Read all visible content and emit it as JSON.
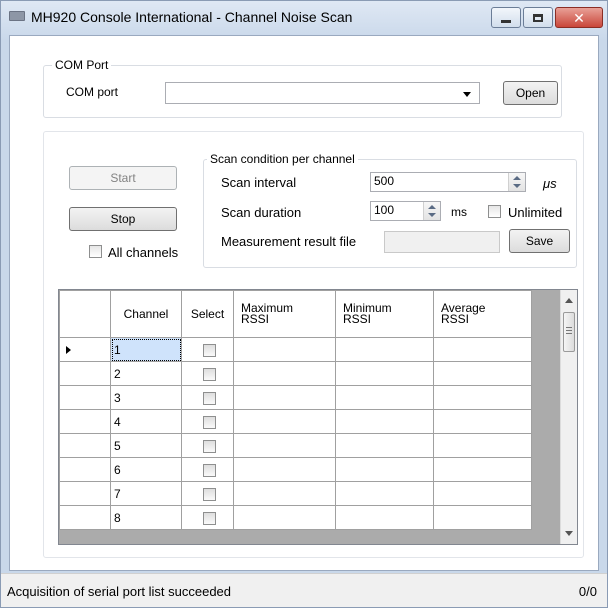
{
  "window": {
    "title": "MH920 Console International - Channel Noise Scan",
    "close_glyph": "✕"
  },
  "com_group": {
    "legend": "COM Port",
    "port_label": "COM port",
    "port_value": "",
    "open_label": "Open"
  },
  "controls": {
    "start_label": "Start",
    "start_enabled": false,
    "stop_label": "Stop",
    "all_channels_label": "All channels",
    "all_channels_checked": false
  },
  "scan_group": {
    "legend": "Scan condition per channel",
    "interval_label": "Scan interval",
    "interval_value": "500",
    "interval_unit": "μs",
    "duration_label": "Scan duration",
    "duration_value": "100",
    "duration_unit": "ms",
    "unlimited_label": "Unlimited",
    "unlimited_checked": false,
    "result_file_label": "Measurement result file",
    "result_file_value": "",
    "save_label": "Save"
  },
  "grid": {
    "columns": {
      "channel": "Channel",
      "select": "Select",
      "max": [
        "Maximum",
        "RSSI"
      ],
      "min": [
        "Minimum",
        "RSSI"
      ],
      "avg": [
        "Average",
        "RSSI"
      ]
    },
    "rows": [
      {
        "channel": "1",
        "selected": false,
        "max": "",
        "min": "",
        "avg": ""
      },
      {
        "channel": "2",
        "selected": false,
        "max": "",
        "min": "",
        "avg": ""
      },
      {
        "channel": "3",
        "selected": false,
        "max": "",
        "min": "",
        "avg": ""
      },
      {
        "channel": "4",
        "selected": false,
        "max": "",
        "min": "",
        "avg": ""
      },
      {
        "channel": "5",
        "selected": false,
        "max": "",
        "min": "",
        "avg": ""
      },
      {
        "channel": "6",
        "selected": false,
        "max": "",
        "min": "",
        "avg": ""
      },
      {
        "channel": "7",
        "selected": false,
        "max": "",
        "min": "",
        "avg": ""
      },
      {
        "channel": "8",
        "selected": false,
        "max": "",
        "min": "",
        "avg": ""
      }
    ]
  },
  "status": {
    "message": "Acquisition of serial port list succeeded",
    "count": "0/0"
  }
}
